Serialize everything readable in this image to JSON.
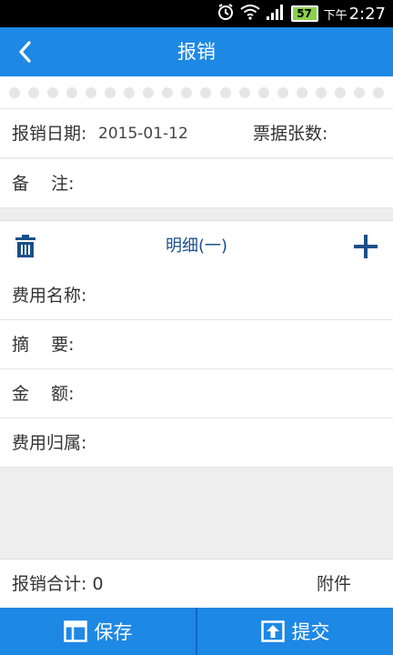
{
  "status_bar": {
    "battery": "57",
    "time_prefix": "下午",
    "time": "2:27",
    "icons": [
      "alarm-icon",
      "wifi-icon",
      "signal-icon",
      "battery-icon"
    ]
  },
  "title_bar": {
    "title": "报销",
    "back_icon": "chevron-left-icon"
  },
  "form": {
    "date_label": "报销日期:",
    "date_value": "2015-01-12",
    "tickets_label": "票据张数:",
    "note_label": "备    注:"
  },
  "detail": {
    "title": "明细(一)",
    "delete_icon": "trash-icon",
    "add_icon": "plus-icon",
    "fields": [
      {
        "label": "费用名称:"
      },
      {
        "label": "摘    要:"
      },
      {
        "label": "金    额:"
      },
      {
        "label": "费用归属:"
      }
    ]
  },
  "summary": {
    "total_label": "报销合计:",
    "total_value": "0",
    "attachment_label": "附件"
  },
  "bottom_bar": {
    "save_label": "保存",
    "submit_label": "提交"
  },
  "colors": {
    "accent": "#1e88e5",
    "detail_title": "#1a4f8a",
    "background": "#eeeeee"
  }
}
